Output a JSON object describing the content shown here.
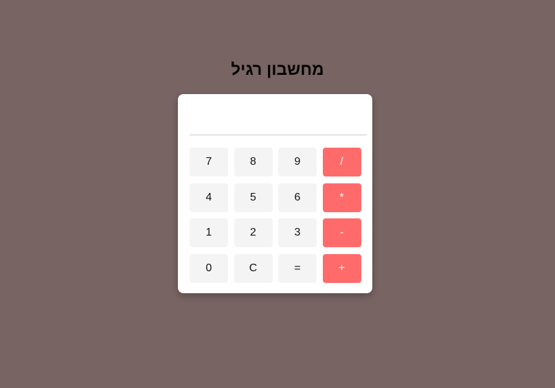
{
  "title": "מחשבון רגיל",
  "display": {
    "value": ""
  },
  "keys": [
    {
      "label": "7",
      "kind": "digit",
      "name": "key-7-button"
    },
    {
      "label": "8",
      "kind": "digit",
      "name": "key-8-button"
    },
    {
      "label": "9",
      "kind": "digit",
      "name": "key-9-button"
    },
    {
      "label": "/",
      "kind": "operator",
      "name": "divide-button"
    },
    {
      "label": "4",
      "kind": "digit",
      "name": "key-4-button"
    },
    {
      "label": "5",
      "kind": "digit",
      "name": "key-5-button"
    },
    {
      "label": "6",
      "kind": "digit",
      "name": "key-6-button"
    },
    {
      "label": "*",
      "kind": "operator",
      "name": "multiply-button"
    },
    {
      "label": "1",
      "kind": "digit",
      "name": "key-1-button"
    },
    {
      "label": "2",
      "kind": "digit",
      "name": "key-2-button"
    },
    {
      "label": "3",
      "kind": "digit",
      "name": "key-3-button"
    },
    {
      "label": "-",
      "kind": "operator",
      "name": "subtract-button"
    },
    {
      "label": "0",
      "kind": "digit",
      "name": "key-0-button"
    },
    {
      "label": "C",
      "kind": "digit",
      "name": "clear-button"
    },
    {
      "label": "=",
      "kind": "digit",
      "name": "equals-button"
    },
    {
      "label": "+",
      "kind": "operator",
      "name": "add-button"
    }
  ],
  "colors": {
    "background": "#786462",
    "operator": "#ff6b6b",
    "key": "#f4f4f4"
  }
}
